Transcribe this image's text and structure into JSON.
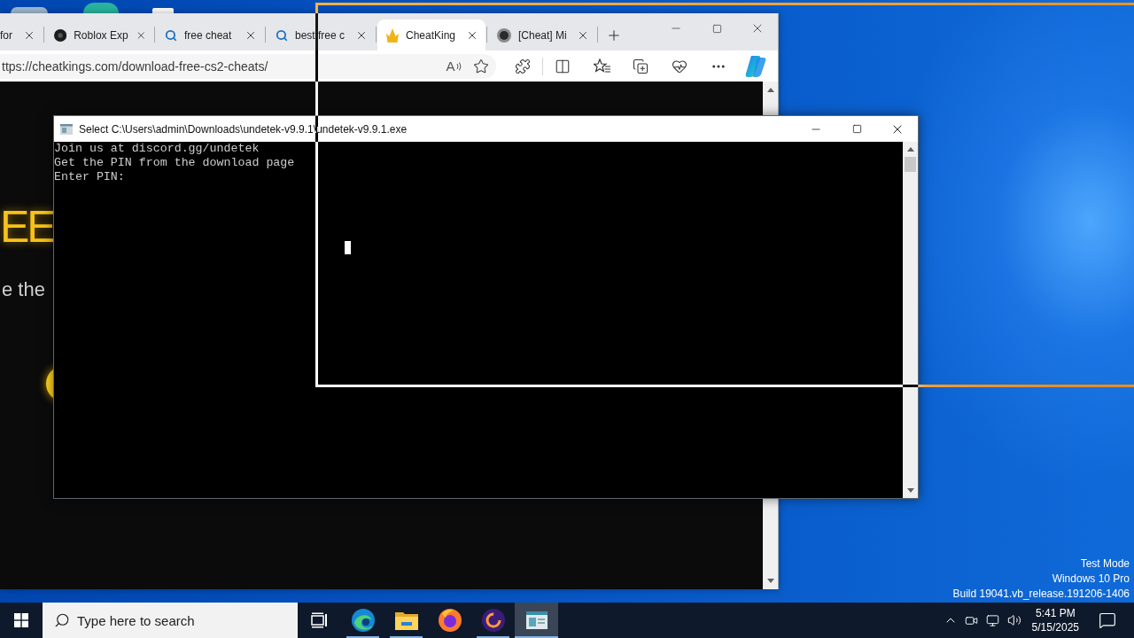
{
  "browser": {
    "tabs": [
      {
        "label": "for",
        "kind": "plain",
        "selected": false
      },
      {
        "label": "Roblox Exp",
        "kind": "disc",
        "selected": false
      },
      {
        "label": "free cheat",
        "kind": "search",
        "selected": false
      },
      {
        "label": "best free c",
        "kind": "search",
        "selected": false
      },
      {
        "label": "CheatKing",
        "kind": "crown",
        "selected": true
      },
      {
        "label": "[Cheat] Mi",
        "kind": "orb",
        "selected": false
      }
    ],
    "address": "ttps://cheatkings.com/download-free-cs2-cheats/",
    "read_aloud_glyph": "A",
    "page": {
      "heading": "EE",
      "subtext": "e the"
    }
  },
  "console": {
    "title": "Select C:\\Users\\admin\\Downloads\\undetek-v9.9.1\\undetek-v9.9.1.exe",
    "lines": [
      "Join us at discord.gg/undetek",
      "Get the PIN from the download page",
      "Enter PIN:"
    ]
  },
  "desktop": {
    "notice_lines": [
      "Test Mode",
      "Windows 10 Pro",
      "Build 19041.vb_release.191206-1406"
    ]
  },
  "taskbar": {
    "search": {
      "placeholder": "Type here to search"
    },
    "apps": [
      {
        "kind": "taskview",
        "running": false,
        "selected": false
      },
      {
        "kind": "edge",
        "running": true,
        "selected": false
      },
      {
        "kind": "explorer",
        "running": true,
        "selected": false
      },
      {
        "kind": "firefox",
        "running": false,
        "selected": false
      },
      {
        "kind": "ring",
        "running": true,
        "selected": false
      },
      {
        "kind": "console",
        "running": true,
        "selected": true
      }
    ],
    "clock": {
      "time": "5:41 PM",
      "date": "5/15/2025"
    }
  }
}
